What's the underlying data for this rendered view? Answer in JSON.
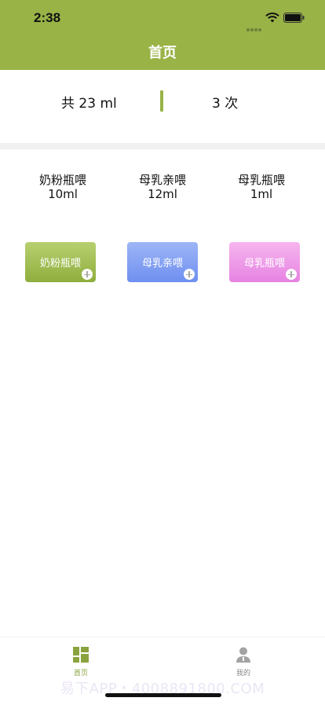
{
  "status_bar": {
    "time": "2:38"
  },
  "nav": {
    "title": "首页"
  },
  "summary": {
    "total": "共 23 ml",
    "count": "3 次"
  },
  "stats": [
    {
      "label": "奶粉瓶喂",
      "value": "10ml"
    },
    {
      "label": "母乳亲喂",
      "value": "12ml"
    },
    {
      "label": "母乳瓶喂",
      "value": "1ml"
    }
  ],
  "buttons": [
    {
      "label": "奶粉瓶喂",
      "color": "#a3c050"
    },
    {
      "label": "母乳亲喂",
      "color": "#86a2f3"
    },
    {
      "label": "母乳瓶喂",
      "color": "#ee9de8"
    }
  ],
  "tabs": [
    {
      "label": "首页",
      "icon": "dashboard-icon",
      "active": true,
      "color": "#8aa33e"
    },
    {
      "label": "我的",
      "icon": "user-icon",
      "active": false,
      "color": "#888888"
    }
  ],
  "watermark": "易下APP・4008891800.COM",
  "colors": {
    "brand": "#99b347",
    "separator": "#f1f1f1"
  }
}
